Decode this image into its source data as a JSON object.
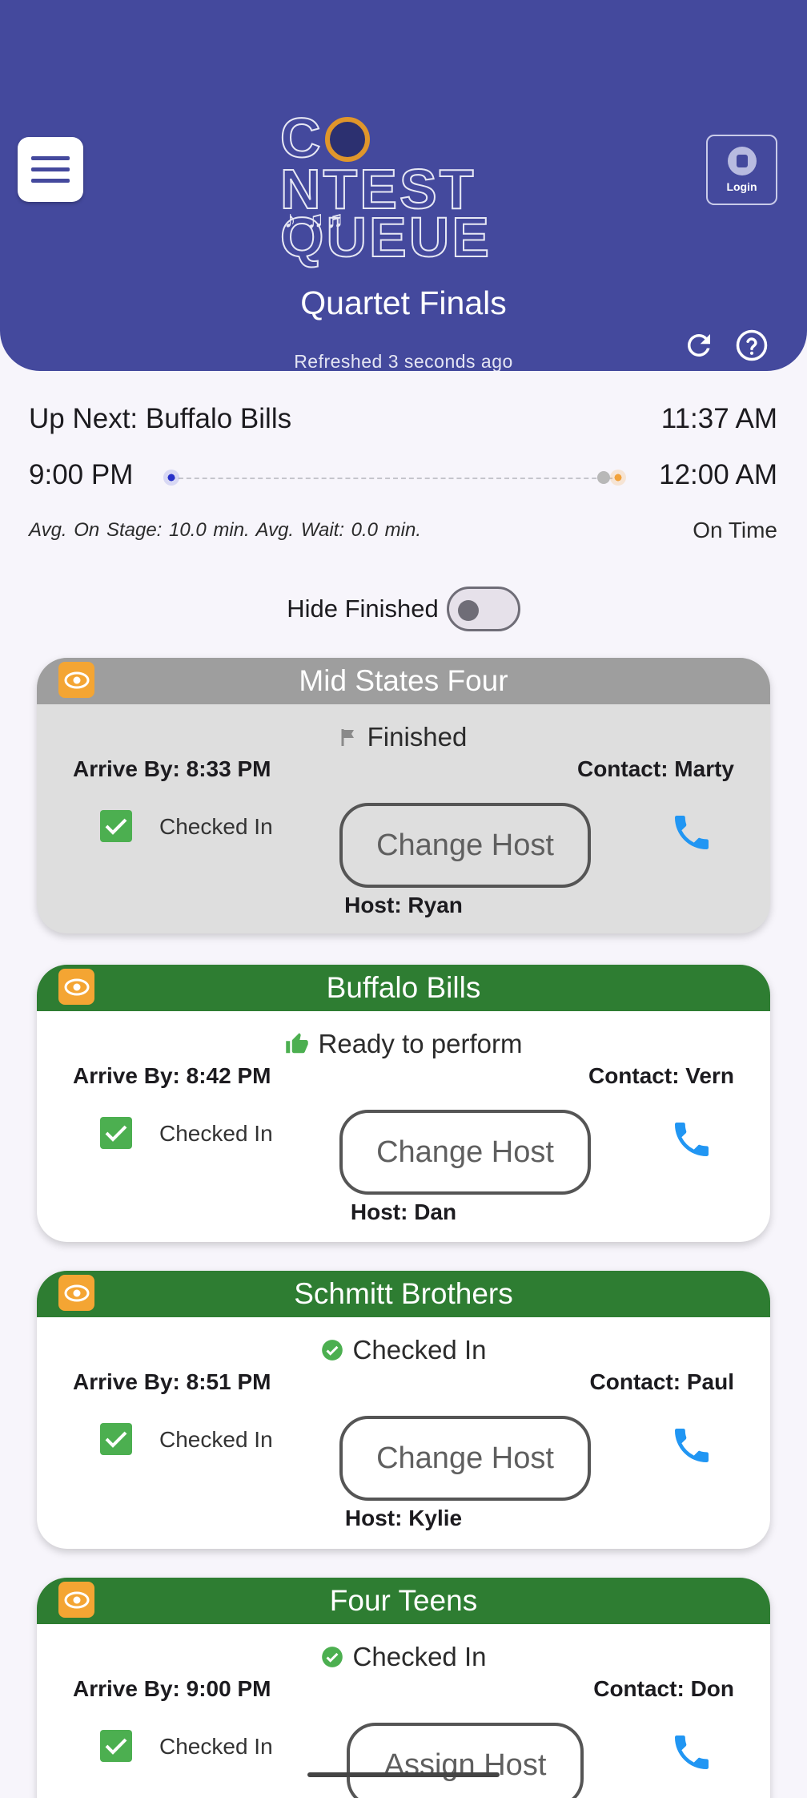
{
  "header": {
    "logo_text_line1": "CONTEST",
    "logo_text_line2": "QUEUE",
    "login_label": "Login",
    "event_title": "Quartet Finals",
    "refreshed": "Refreshed 3 seconds ago"
  },
  "summary": {
    "up_next": "Up Next: Buffalo Bills",
    "current_time": "11:37 AM",
    "start_time": "9:00 PM",
    "end_time": "12:00 AM",
    "averages": "Avg. On Stage: 10.0 min.   Avg. Wait: 0.0 min.",
    "status": "On Time"
  },
  "filter": {
    "hide_finished_label": "Hide Finished",
    "hide_finished_on": false
  },
  "colors": {
    "header_bg": "#44499d",
    "card_head_active": "#2e7d32",
    "card_head_finished": "#9e9e9e",
    "eye_badge": "#f4a533",
    "phone": "#2196f3",
    "check": "#4caf50"
  },
  "cards": [
    {
      "name": "Mid States Four",
      "status": "Finished",
      "status_icon": "flag-icon",
      "arrive_label": "Arrive By:",
      "arrive_time": "8:33 PM",
      "contact_label": "Contact:",
      "contact_name": "Marty",
      "checked_label": "Checked In",
      "host_button": "Change Host",
      "host": "Host: Ryan"
    },
    {
      "name": "Buffalo Bills",
      "status": "Ready to perform",
      "status_icon": "thumbs-up-icon",
      "arrive_label": "Arrive By:",
      "arrive_time": "8:42 PM",
      "contact_label": "Contact:",
      "contact_name": "Vern",
      "checked_label": "Checked In",
      "host_button": "Change Host",
      "host": "Host: Dan"
    },
    {
      "name": "Schmitt Brothers",
      "status": "Checked In",
      "status_icon": "check-circle-icon",
      "arrive_label": "Arrive By:",
      "arrive_time": "8:51 PM",
      "contact_label": "Contact:",
      "contact_name": "Paul",
      "checked_label": "Checked In",
      "host_button": "Change Host",
      "host": "Host: Kylie"
    },
    {
      "name": "Four Teens",
      "status": "Checked In",
      "status_icon": "check-circle-icon",
      "arrive_label": "Arrive By:",
      "arrive_time": "9:00 PM",
      "contact_label": "Contact:",
      "contact_name": "Don",
      "checked_label": "Checked In",
      "host_button": "Assign Host",
      "host": ""
    }
  ]
}
